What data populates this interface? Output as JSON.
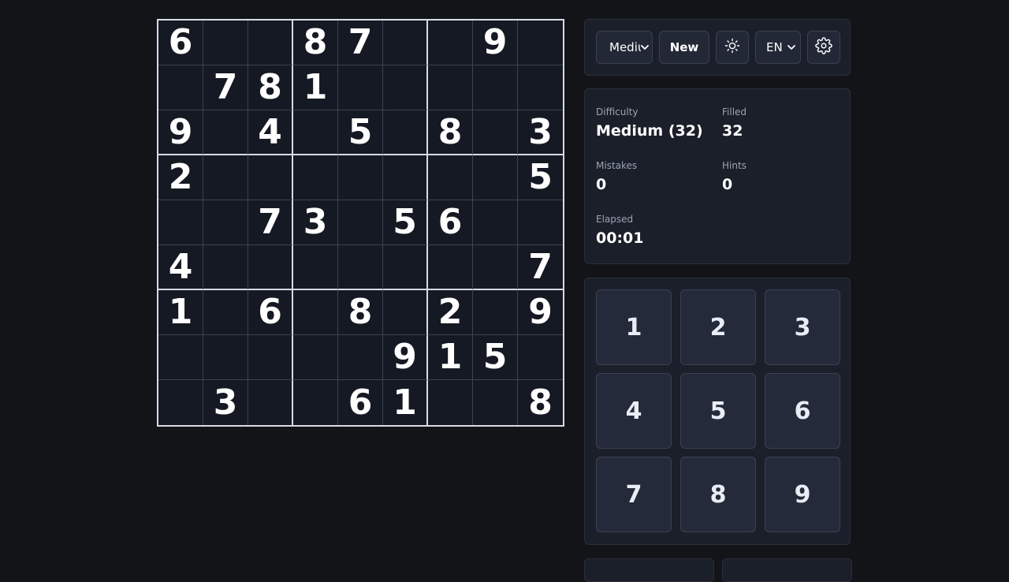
{
  "board": {
    "cells": [
      "6",
      "",
      "",
      "8",
      "7",
      "",
      "",
      "9",
      "",
      "",
      "7",
      "8",
      "1",
      "",
      "",
      "",
      "",
      "",
      "9",
      "",
      "4",
      "",
      "5",
      "",
      "8",
      "",
      "3",
      "2",
      "",
      "",
      "",
      "",
      "",
      "",
      "",
      "5",
      "",
      "",
      "7",
      "3",
      "",
      "5",
      "6",
      "",
      "",
      "4",
      "",
      "",
      "",
      "",
      "",
      "",
      "",
      "7",
      "1",
      "",
      "6",
      "",
      "8",
      "",
      "2",
      "",
      "9",
      "",
      "",
      "",
      "",
      "",
      "9",
      "1",
      "5",
      "",
      "",
      "3",
      "",
      "",
      "6",
      "1",
      "",
      "",
      "8"
    ]
  },
  "toolbar": {
    "difficulty_select": "Medium",
    "new_label": "New",
    "theme_icon": "sun-icon",
    "language": "EN",
    "settings_icon": "gear-icon"
  },
  "stats": {
    "difficulty_label": "Difficulty",
    "difficulty_value": "Medium (32)",
    "filled_label": "Filled",
    "filled_value": "32",
    "mistakes_label": "Mistakes",
    "mistakes_value": "0",
    "hints_label": "Hints",
    "hints_value": "0",
    "elapsed_label": "Elapsed",
    "elapsed_value": "00:01"
  },
  "numpad": {
    "digits": [
      "1",
      "2",
      "3",
      "4",
      "5",
      "6",
      "7",
      "8",
      "9"
    ]
  },
  "colors": {
    "background": "#121418",
    "panel": "#1b1f29",
    "button": "#252a3a",
    "grid_major": "#d7dbe5",
    "grid_minor": "#3b4252",
    "label": "#9aa3b5"
  }
}
